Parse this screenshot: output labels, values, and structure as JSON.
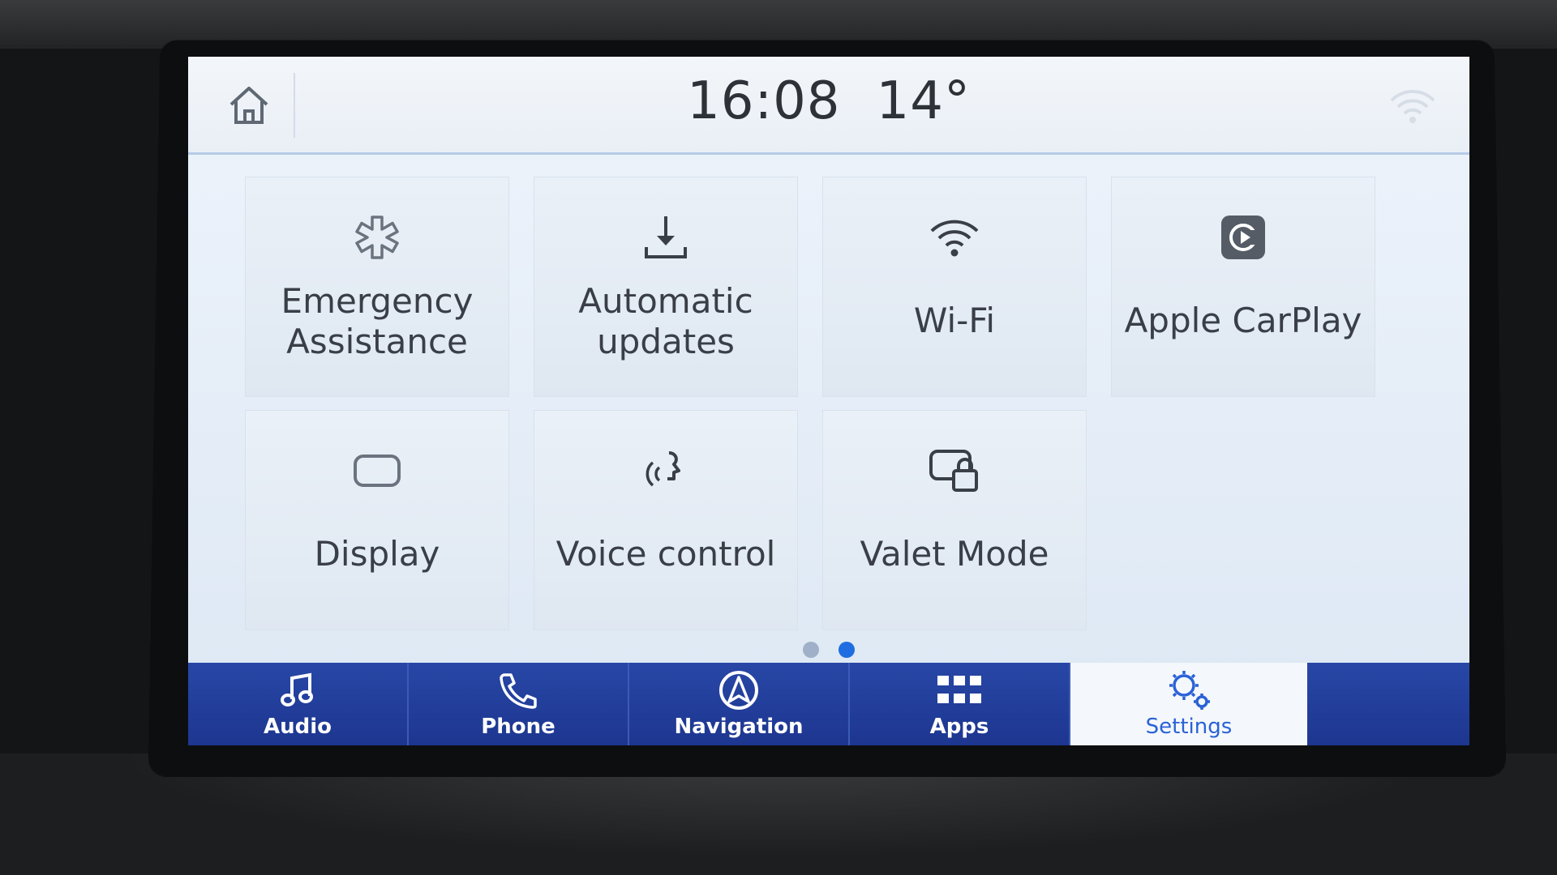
{
  "status_bar": {
    "time": "16:08",
    "temperature": "14°",
    "home_icon": "home-icon",
    "wifi_icon": "wifi-signal-icon"
  },
  "tiles": [
    {
      "label_line1": "Emergency",
      "label_line2": "Assistance",
      "icon": "medical-star-icon"
    },
    {
      "label_line1": "Automatic",
      "label_line2": "updates",
      "icon": "download-icon"
    },
    {
      "label": "Wi-Fi",
      "icon": "wifi-icon"
    },
    {
      "label": "Apple CarPlay",
      "icon": "carplay-icon"
    },
    {
      "label": "Display",
      "icon": "display-icon"
    },
    {
      "label": "Voice control",
      "icon": "voice-icon"
    },
    {
      "label": "Valet Mode",
      "icon": "valet-lock-icon"
    }
  ],
  "pager": {
    "pages": 2,
    "active_page": 2,
    "inactive_color": "#9fb0c8",
    "active_color": "#1f6de0"
  },
  "navbar": {
    "items": [
      {
        "label": "Audio",
        "icon": "music-note-icon"
      },
      {
        "label": "Phone",
        "icon": "phone-icon"
      },
      {
        "label": "Navigation",
        "icon": "navigation-icon"
      },
      {
        "label": "Apps",
        "icon": "apps-grid-icon"
      },
      {
        "label": "Settings",
        "icon": "settings-gears-icon",
        "active": true
      }
    ],
    "bar_color": "#2146a3",
    "active_text_color": "#2a62d6"
  }
}
